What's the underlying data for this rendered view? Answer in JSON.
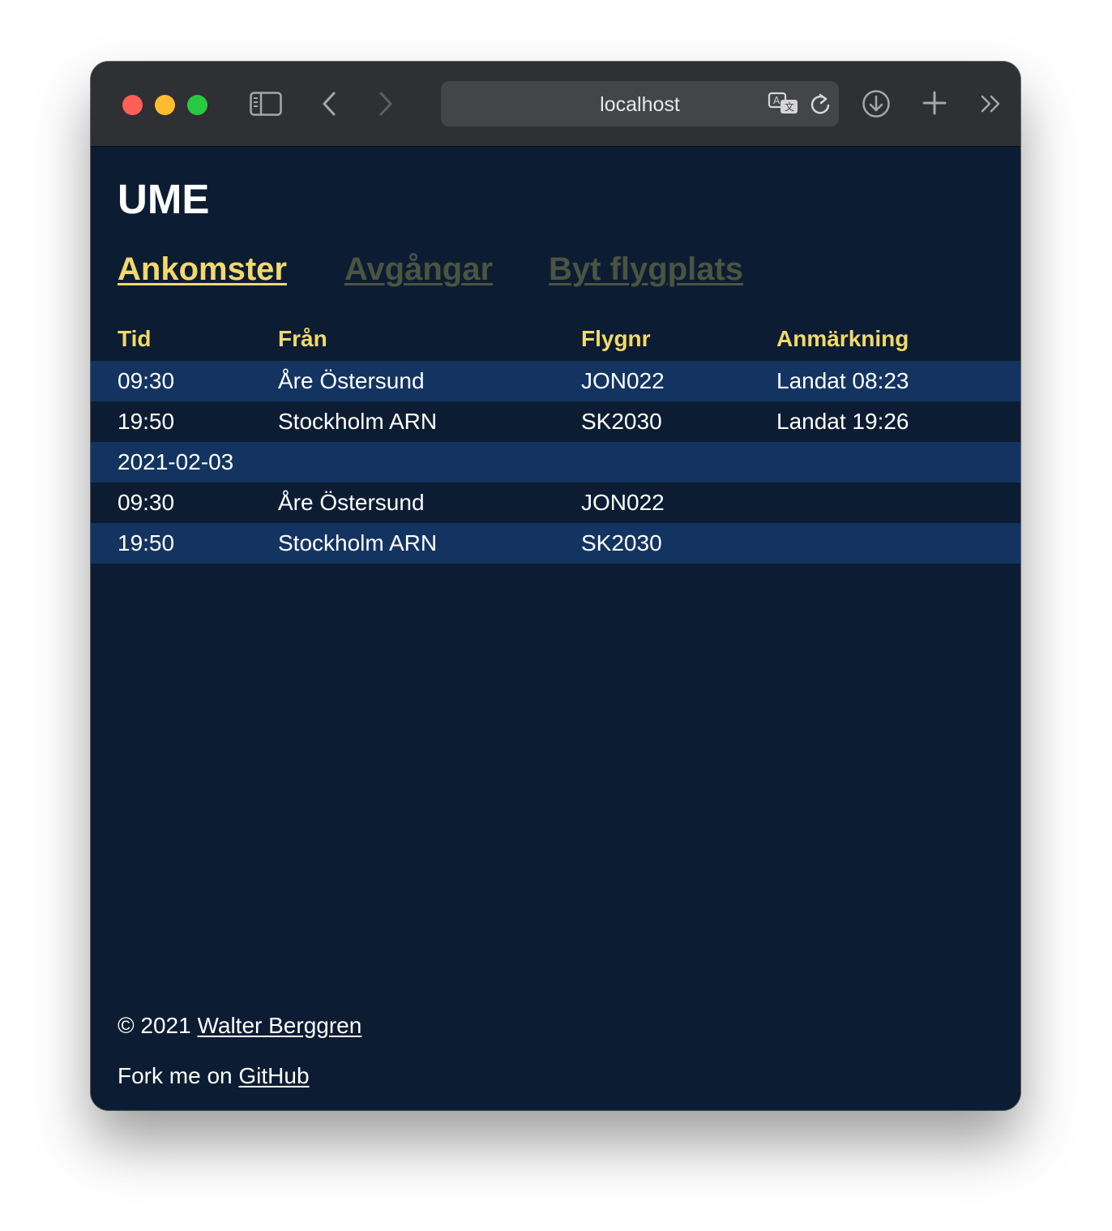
{
  "browser": {
    "url": "localhost",
    "icons": [
      "sidebar-icon",
      "back-icon",
      "forward-icon",
      "translate-icon",
      "reload-icon",
      "download-icon",
      "new-tab-icon",
      "more-icon"
    ]
  },
  "page": {
    "title": "UME",
    "nav": {
      "arrivals": "Ankomster",
      "departures": "Avgångar",
      "change_airport": "Byt flygplats"
    },
    "colors": {
      "background": "#0c1d33",
      "stripe": "#133460",
      "accent": "#f3d96a",
      "inactive_link": "#4a5440"
    }
  },
  "table": {
    "headers": [
      "Tid",
      "Från",
      "Flygnr",
      "Anmärkning"
    ],
    "rows": [
      [
        "09:30",
        "Åre Östersund",
        "JON022",
        "Landat 08:23"
      ],
      [
        "19:50",
        "Stockholm ARN",
        "SK2030",
        "Landat 19:26"
      ],
      [
        "2021-02-03",
        "",
        "",
        ""
      ],
      [
        "09:30",
        "Åre Östersund",
        "JON022",
        ""
      ],
      [
        "19:50",
        "Stockholm ARN",
        "SK2030",
        ""
      ]
    ]
  },
  "footer": {
    "copyright_prefix": "© 2021",
    "author": "Walter Berggren",
    "fork_prefix": "Fork me on",
    "github": "GitHub"
  }
}
